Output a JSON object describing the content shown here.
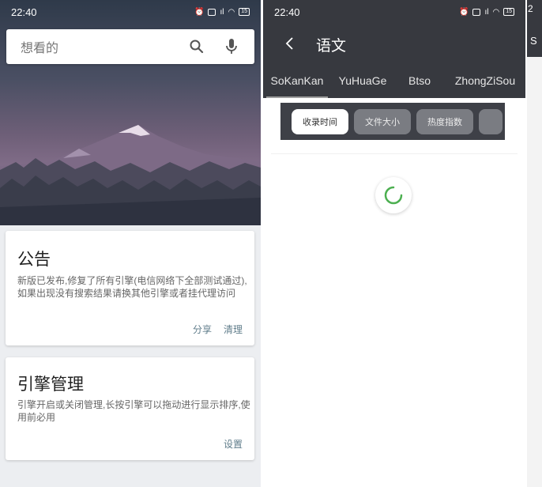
{
  "screen1": {
    "status_time": "22:40",
    "battery": "15",
    "search_placeholder": "想看的",
    "notice_card": {
      "title": "公告",
      "body": "新版已发布,修复了所有引擎(电信网络下全部测试通过),如果出现没有搜索结果请换其他引擎或者挂代理访问",
      "actions": [
        "分享",
        "清理"
      ]
    },
    "engine_card": {
      "title": "引擎管理",
      "body": "引擎开启或关闭管理,长按引擎可以拖动进行显示排序,使用前必用",
      "action": "设置"
    }
  },
  "screen2": {
    "status_time": "22:40",
    "battery": "15",
    "title": "语文",
    "tabs": [
      "SoKanKan",
      "YuHuaGe",
      "Btso",
      "ZhongZiSou"
    ],
    "active_tab": "SoKanKan",
    "filters": [
      "收录时间",
      "文件大小",
      "热度指数"
    ],
    "active_filter": "收录时间"
  },
  "screen3": {
    "status_fragment": "2",
    "tab_fragment": "S"
  },
  "icons": {
    "search": "search-icon",
    "mic": "mic-icon",
    "back": "back-arrow-icon",
    "loading": "loading-spinner-icon"
  },
  "colors": {
    "appbar": "#37393f",
    "filter_bar": "#3e4047",
    "action_text": "#607d8b",
    "background": "#eceef1"
  }
}
